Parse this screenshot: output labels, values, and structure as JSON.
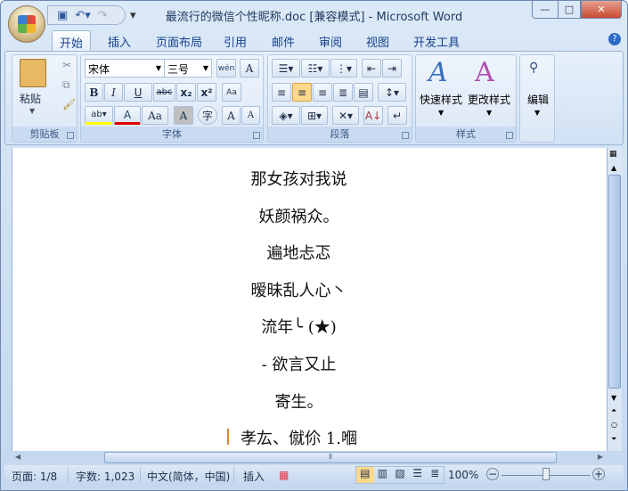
{
  "title": "最流行的微信个性昵称.doc [兼容模式] - Microsoft Word",
  "tabs": [
    "开始",
    "插入",
    "页面布局",
    "引用",
    "邮件",
    "审阅",
    "视图",
    "开发工具"
  ],
  "clipboard": {
    "paste": "粘贴",
    "label": "剪贴板"
  },
  "font": {
    "name": "宋体",
    "size": "三号",
    "label": "字体",
    "bold": "B",
    "italic": "I",
    "underline": "U",
    "strike": "abc",
    "sub": "x₂",
    "sup": "x²",
    "case": "Aa",
    "grow": "A",
    "shrink": "A",
    "color_a": "A",
    "char_shade": "A",
    "enclose": "字",
    "phonetic": "wén",
    "border": "A"
  },
  "paragraph": {
    "label": "段落"
  },
  "styles": {
    "quick": "快速样式",
    "change": "更改样式",
    "label": "样式"
  },
  "editing": {
    "label": "编辑"
  },
  "document": {
    "lines": [
      "那女孩对我说",
      "妖颜祸众。",
      "遍地忐忑",
      "暧昧乱人心丶",
      "流年╰ (★)",
      "- 欲言又止",
      "寄生。",
      "孝厷、僦伱 1.嗰"
    ]
  },
  "status": {
    "page": "页面: 1/8",
    "words": "字数: 1,023",
    "lang": "中文(简体，中国)",
    "mode": "插入",
    "zoom": "100%",
    "zoom_fraction": 0.5
  },
  "colors": {
    "accent": "#15428b",
    "highlight": "#ffff00",
    "font_color": "#e00000",
    "active_align": "#fcd98a"
  }
}
